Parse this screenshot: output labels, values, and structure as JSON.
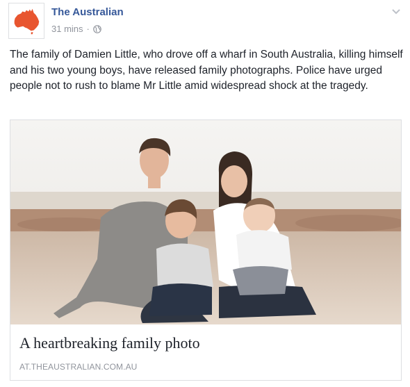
{
  "post": {
    "page_name": "The Australian",
    "timestamp": "31 mins",
    "separator": "·",
    "privacy_icon": "globe-icon",
    "options_icon": "chevron-down-icon",
    "avatar_icon": "australia-map-logo",
    "message": "The family of Damien Little, who drove off a wharf in South Australia, killing himself and his two young boys, have released family photographs. Police have urged people not to rush to blame Mr Little amid widespread shock at the tragedy."
  },
  "link_preview": {
    "title": "A heartbreaking family photo",
    "domain": "AT.THEAUSTRALIAN.COM.AU"
  },
  "colors": {
    "link_blue": "#365899",
    "meta_gray": "#90949c",
    "logo_red": "#e8552f",
    "border": "#dddfe2",
    "text": "#1d2129"
  }
}
